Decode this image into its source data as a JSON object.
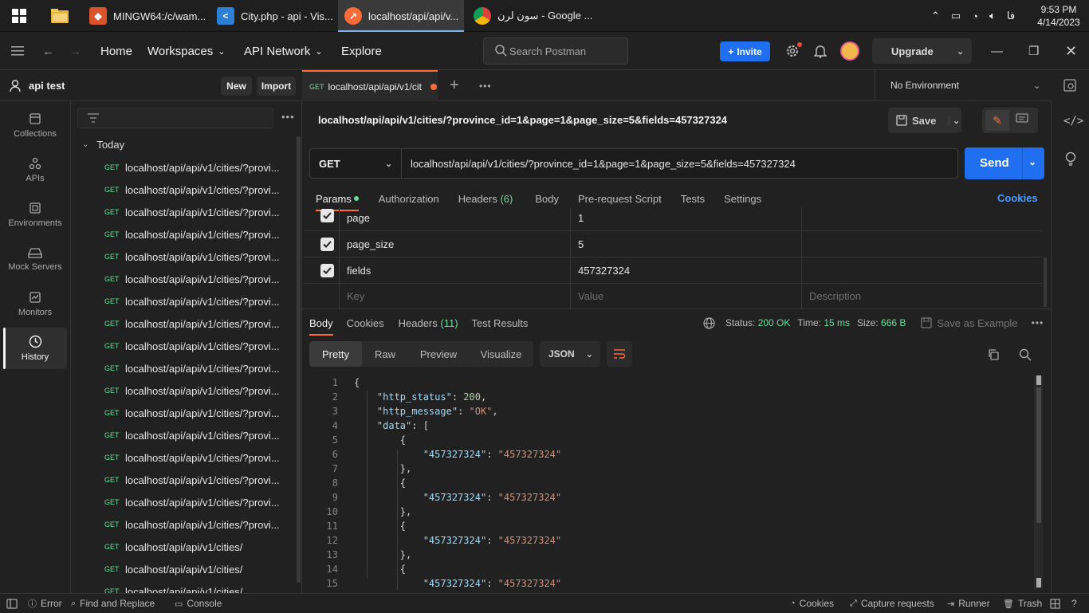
{
  "taskbar": {
    "apps": [
      {
        "label": "",
        "icon": "file-explorer-icon"
      },
      {
        "label": "MINGW64:/c/wam...",
        "icon": "git-bash-icon"
      },
      {
        "label": "City.php - api - Vis...",
        "icon": "vscode-icon"
      },
      {
        "label": "localhost/api/api/v...",
        "icon": "postman-icon"
      },
      {
        "label": "سون لرن - Google ...",
        "icon": "chrome-icon"
      }
    ],
    "language": "فا",
    "time": "9:53 PM",
    "date": "4/14/2023"
  },
  "header": {
    "nav": [
      "Home",
      "Workspaces",
      "API Network",
      "Explore"
    ],
    "search_placeholder": "Search Postman",
    "invite_label": "Invite",
    "upgrade_label": "Upgrade"
  },
  "workspace": {
    "name": "api test",
    "new_label": "New",
    "import_label": "Import"
  },
  "rail": [
    {
      "label": "Collections",
      "icon": "collections-icon"
    },
    {
      "label": "APIs",
      "icon": "apis-icon"
    },
    {
      "label": "Environments",
      "icon": "environments-icon"
    },
    {
      "label": "Mock Servers",
      "icon": "mock-servers-icon"
    },
    {
      "label": "Monitors",
      "icon": "monitors-icon"
    },
    {
      "label": "History",
      "icon": "history-icon"
    }
  ],
  "history": {
    "group_label": "Today",
    "items": [
      {
        "method": "GET",
        "url": "localhost/api/api/v1/cities/?provi..."
      },
      {
        "method": "GET",
        "url": "localhost/api/api/v1/cities/?provi..."
      },
      {
        "method": "GET",
        "url": "localhost/api/api/v1/cities/?provi..."
      },
      {
        "method": "GET",
        "url": "localhost/api/api/v1/cities/?provi..."
      },
      {
        "method": "GET",
        "url": "localhost/api/api/v1/cities/?provi..."
      },
      {
        "method": "GET",
        "url": "localhost/api/api/v1/cities/?provi..."
      },
      {
        "method": "GET",
        "url": "localhost/api/api/v1/cities/?provi..."
      },
      {
        "method": "GET",
        "url": "localhost/api/api/v1/cities/?provi..."
      },
      {
        "method": "GET",
        "url": "localhost/api/api/v1/cities/?provi..."
      },
      {
        "method": "GET",
        "url": "localhost/api/api/v1/cities/?provi..."
      },
      {
        "method": "GET",
        "url": "localhost/api/api/v1/cities/?provi..."
      },
      {
        "method": "GET",
        "url": "localhost/api/api/v1/cities/?provi..."
      },
      {
        "method": "GET",
        "url": "localhost/api/api/v1/cities/?provi..."
      },
      {
        "method": "GET",
        "url": "localhost/api/api/v1/cities/?provi..."
      },
      {
        "method": "GET",
        "url": "localhost/api/api/v1/cities/?provi..."
      },
      {
        "method": "GET",
        "url": "localhost/api/api/v1/cities/?provi..."
      },
      {
        "method": "GET",
        "url": "localhost/api/api/v1/cities/?provi..."
      },
      {
        "method": "GET",
        "url": "localhost/api/api/v1/cities/"
      },
      {
        "method": "GET",
        "url": "localhost/api/api/v1/cities/"
      },
      {
        "method": "GET",
        "url": "localhost/api/api/v1/cities/"
      }
    ]
  },
  "tab": {
    "method": "GET",
    "url": "localhost/api/api/v1/cit"
  },
  "environment": "No Environment",
  "request": {
    "title": "localhost/api/api/v1/cities/?province_id=1&page=1&page_size=5&fields=457327324",
    "save_label": "Save",
    "method": "GET",
    "url": "localhost/api/api/v1/cities/?province_id=1&page=1&page_size=5&fields=457327324",
    "send_label": "Send",
    "tabs": [
      "Params",
      "Authorization",
      "Headers",
      "Body",
      "Pre-request Script",
      "Tests",
      "Settings"
    ],
    "headers_count": "(6)",
    "cookies_label": "Cookies",
    "params": [
      {
        "key": "page",
        "value": "1"
      },
      {
        "key": "page_size",
        "value": "5"
      },
      {
        "key": "fields",
        "value": "457327324"
      }
    ],
    "key_placeholder": "Key",
    "value_placeholder": "Value",
    "description_placeholder": "Description"
  },
  "response": {
    "tabs": [
      "Body",
      "Cookies",
      "Headers",
      "Test Results"
    ],
    "headers_count": "(11)",
    "status_label": "Status:",
    "status_value": "200 OK",
    "time_label": "Time:",
    "time_value": "15 ms",
    "size_label": "Size:",
    "size_value": "666 B",
    "save_example_label": "Save as Example",
    "view_modes": [
      "Pretty",
      "Raw",
      "Preview",
      "Visualize"
    ],
    "format": "JSON"
  },
  "code_lines": [
    {
      "n": "1",
      "t": "{"
    },
    {
      "n": "2",
      "t": "    \"http_status\": 200,"
    },
    {
      "n": "3",
      "t": "    \"http_message\": \"OK\","
    },
    {
      "n": "4",
      "t": "    \"data\": ["
    },
    {
      "n": "5",
      "t": "        {"
    },
    {
      "n": "6",
      "t": "            \"457327324\": \"457327324\""
    },
    {
      "n": "7",
      "t": "        },"
    },
    {
      "n": "8",
      "t": "        {"
    },
    {
      "n": "9",
      "t": "            \"457327324\": \"457327324\""
    },
    {
      "n": "10",
      "t": "        },"
    },
    {
      "n": "11",
      "t": "        {"
    },
    {
      "n": "12",
      "t": "            \"457327324\": \"457327324\""
    },
    {
      "n": "13",
      "t": "        },"
    },
    {
      "n": "14",
      "t": "        {"
    },
    {
      "n": "15",
      "t": "            \"457327324\": \"457327324\""
    }
  ],
  "statusbar": {
    "error": "Error",
    "find_replace": "Find and Replace",
    "console": "Console",
    "cookies": "Cookies",
    "capture": "Capture requests",
    "runner": "Runner",
    "trash": "Trash"
  },
  "colors": {
    "accent": "#ff6c37",
    "primary": "#1f6ff0",
    "get_method": "#6bdd9a",
    "status_ok": "#6bdd9a"
  }
}
